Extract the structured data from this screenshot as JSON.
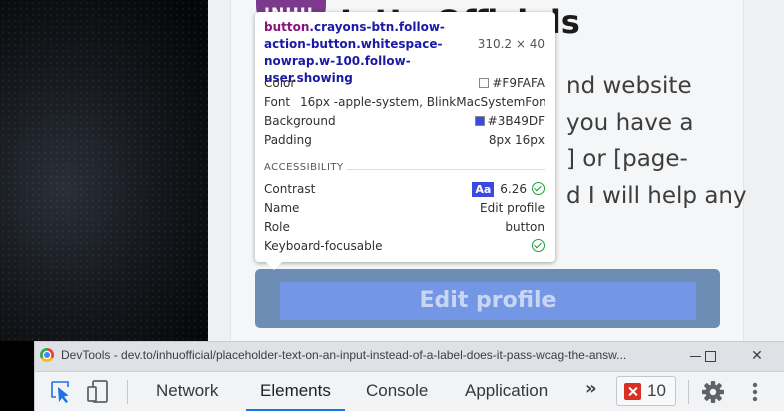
{
  "page": {
    "avatar_text": "INHU",
    "profile_name": "InHu Officials",
    "bio_lines": [
      "nd website",
      " you have a",
      "] or [page-",
      "d I will help any"
    ],
    "edit_button_label": "Edit profile"
  },
  "tooltip": {
    "selector_tag": "button",
    "selector_classes": ".crayons-btn.follow-action-button.whitespace-nowrap.w-100.follow-user.showing",
    "size": "310.2 × 40",
    "rows": [
      {
        "key": "Color",
        "value": "#F9FAFA",
        "swatch": "#F9FAFA"
      },
      {
        "key": "Font",
        "value": "16px -apple-system, BlinkMacSystemFon…"
      },
      {
        "key": "Background",
        "value": "#3B49DF",
        "swatch": "#3B49DF"
      },
      {
        "key": "Padding",
        "value": "8px 16px"
      }
    ],
    "accessibility_heading": "ACCESSIBILITY",
    "accessibility": {
      "contrast_label": "Contrast",
      "contrast_badge": "Aa",
      "contrast_value": "6.26",
      "name_label": "Name",
      "name_value": "Edit profile",
      "role_label": "Role",
      "role_value": "button",
      "keyboard_label": "Keyboard-focusable"
    }
  },
  "devtools": {
    "title": "DevTools - dev.to/inhuofficial/placeholder-text-on-an-input-instead-of-a-label-does-it-pass-wcag-the-answ...",
    "tabs": [
      "Network",
      "Elements",
      "Console",
      "Application"
    ],
    "active_tab": "Elements",
    "more_label": "»",
    "error_count": "10",
    "window_controls": {
      "minimize": "",
      "maximize": "",
      "close": "✕"
    }
  },
  "colors": {
    "button_background": "#3B49DF",
    "button_text": "#F9FAFA",
    "active_tab_underline": "#1a73e8",
    "error_red": "#d93025"
  },
  "icons": [
    "inspect-element-icon",
    "device-toolbar-icon",
    "error-icon",
    "settings-gear-icon",
    "more-vertical-icon",
    "chrome-logo-icon"
  ]
}
